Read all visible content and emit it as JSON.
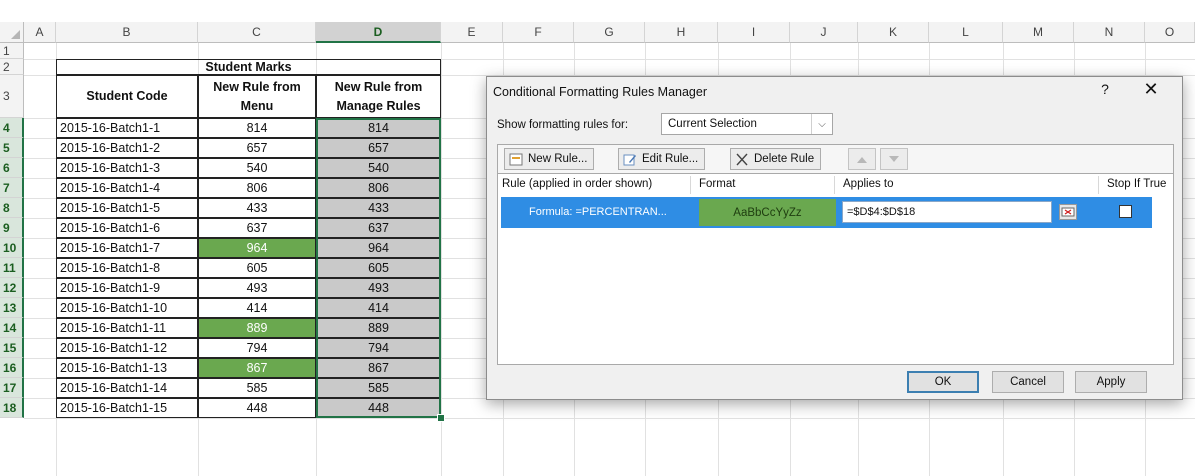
{
  "sheet": {
    "columns": [
      "A",
      "B",
      "C",
      "D",
      "E",
      "F",
      "G",
      "H",
      "I",
      "J",
      "K",
      "L",
      "M",
      "N",
      "O"
    ],
    "rows": [
      "1",
      "2",
      "3",
      "4",
      "5",
      "6",
      "7",
      "8",
      "9",
      "10",
      "11",
      "12",
      "13",
      "14",
      "15",
      "16",
      "17",
      "18"
    ],
    "table": {
      "title": "Student Marks",
      "headers": [
        "Student Code",
        "New Rule from Menu",
        "New Rule from Manage Rules"
      ],
      "data": [
        [
          "2015-16-Batch1-1",
          "814",
          "814"
        ],
        [
          "2015-16-Batch1-2",
          "657",
          "657"
        ],
        [
          "2015-16-Batch1-3",
          "540",
          "540"
        ],
        [
          "2015-16-Batch1-4",
          "806",
          "806"
        ],
        [
          "2015-16-Batch1-5",
          "433",
          "433"
        ],
        [
          "2015-16-Batch1-6",
          "637",
          "637"
        ],
        [
          "2015-16-Batch1-7",
          "964",
          "964"
        ],
        [
          "2015-16-Batch1-8",
          "605",
          "605"
        ],
        [
          "2015-16-Batch1-9",
          "493",
          "493"
        ],
        [
          "2015-16-Batch1-10",
          "414",
          "414"
        ],
        [
          "2015-16-Batch1-11",
          "889",
          "889"
        ],
        [
          "2015-16-Batch1-12",
          "794",
          "794"
        ],
        [
          "2015-16-Batch1-13",
          "867",
          "867"
        ],
        [
          "2015-16-Batch1-14",
          "585",
          "585"
        ],
        [
          "2015-16-Batch1-15",
          "448",
          "448"
        ]
      ],
      "highlighted_menu_values": [
        "964",
        "889",
        "867"
      ]
    },
    "selected_column": "D",
    "colors": {
      "highlight": "#6aa84f",
      "selection_fill": "#c9c9c9",
      "selection_border": "#217346"
    }
  },
  "dialog": {
    "title": "Conditional Formatting Rules Manager",
    "help": "?",
    "close": "✕",
    "show_label": "Show formatting rules for:",
    "show_value": "Current Selection",
    "toolbar": {
      "new_rule": "New Rule...",
      "edit_rule": "Edit Rule...",
      "delete_rule": "Delete Rule"
    },
    "list_headers": {
      "rule": "Rule (applied in order shown)",
      "format": "Format",
      "applies_to": "Applies to",
      "stop_if_true": "Stop If True"
    },
    "rule": {
      "text": "Formula: =PERCENTRAN...",
      "format_preview": "AaBbCcYyZz",
      "applies_to": "=$D$4:$D$18",
      "stop_if_true": false
    },
    "buttons": {
      "ok": "OK",
      "cancel": "Cancel",
      "apply": "Apply"
    },
    "colors": {
      "selected_row": "#2f8de4",
      "format_fill": "#6aa84f"
    }
  }
}
